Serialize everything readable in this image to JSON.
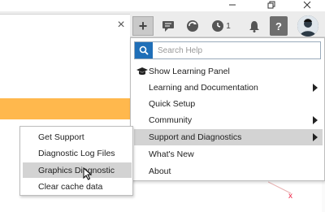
{
  "window": {
    "minimize_icon": "minimize-icon",
    "restore_icon": "restore-icon",
    "close_icon": "close-icon"
  },
  "toolbar": {
    "tab_close_glyph": "×",
    "plus_glyph": "+",
    "notification_count": "1",
    "help_glyph": "?"
  },
  "help_menu": {
    "search_placeholder": "Search Help",
    "items": [
      {
        "label": "Show Learning Panel",
        "has_submenu": false,
        "icon": "mortarboard-icon"
      },
      {
        "label": "Learning and Documentation",
        "has_submenu": true
      },
      {
        "label": "Quick Setup",
        "has_submenu": false
      },
      {
        "label": "Community",
        "has_submenu": true
      },
      {
        "label": "Support and Diagnostics",
        "has_submenu": true,
        "active": true
      },
      {
        "label": "What's New",
        "has_submenu": false
      },
      {
        "label": "About",
        "has_submenu": false
      }
    ]
  },
  "sub_menu": {
    "items": [
      {
        "label": "Get Support"
      },
      {
        "label": "Diagnostic Log Files"
      },
      {
        "label": "Graphics Diagnostic",
        "hovered": true
      },
      {
        "label": "Clear cache data"
      }
    ]
  },
  "colors": {
    "accent_blue": "#1f6fb8",
    "orange_bar": "#ffb84d",
    "menu_highlight": "#d3d3d3"
  }
}
